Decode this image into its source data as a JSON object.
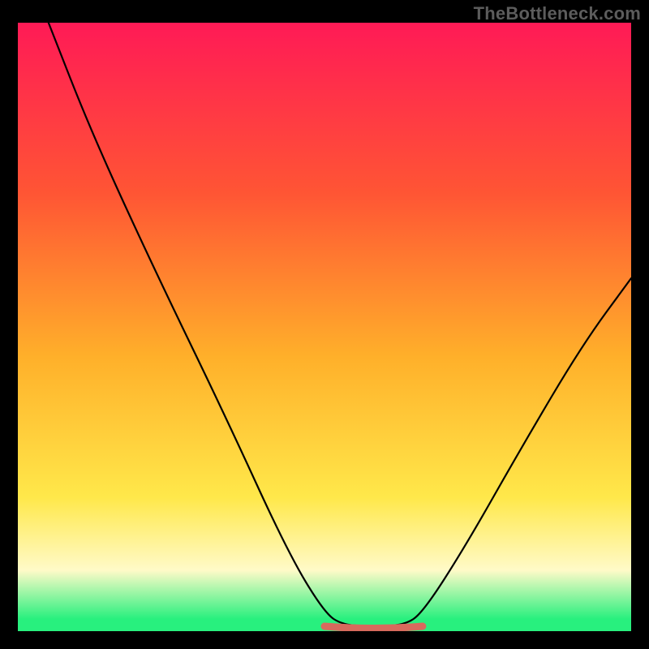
{
  "watermark": "TheBottleneck.com",
  "colors": {
    "background": "#000000",
    "watermark_text": "#5c5c5c",
    "gradient_top": "#ff1a56",
    "gradient_upper": "#ff5534",
    "gradient_mid": "#ffb02a",
    "gradient_lower": "#ffe84a",
    "gradient_pale": "#fffac8",
    "gradient_base": "#28f07e",
    "curve": "#000000",
    "highlight": "#d86a5d"
  },
  "chart_data": {
    "type": "line",
    "title": "",
    "xlabel": "",
    "ylabel": "",
    "xlim": [
      0,
      100
    ],
    "ylim": [
      0,
      100
    ],
    "gradient_stops": [
      {
        "offset": 0,
        "color": "#ff1a56"
      },
      {
        "offset": 28,
        "color": "#ff5534"
      },
      {
        "offset": 55,
        "color": "#ffb02a"
      },
      {
        "offset": 78,
        "color": "#ffe84a"
      },
      {
        "offset": 90,
        "color": "#fffac8"
      },
      {
        "offset": 98,
        "color": "#28f07e"
      },
      {
        "offset": 100,
        "color": "#28f07e"
      }
    ],
    "series": [
      {
        "name": "bottleneck-curve",
        "points": [
          {
            "x": 5,
            "y": 100
          },
          {
            "x": 12,
            "y": 82
          },
          {
            "x": 22,
            "y": 60
          },
          {
            "x": 34,
            "y": 35
          },
          {
            "x": 44,
            "y": 13
          },
          {
            "x": 50,
            "y": 3
          },
          {
            "x": 53,
            "y": 1
          },
          {
            "x": 58,
            "y": 0.8
          },
          {
            "x": 63,
            "y": 1
          },
          {
            "x": 66,
            "y": 3
          },
          {
            "x": 73,
            "y": 14
          },
          {
            "x": 82,
            "y": 30
          },
          {
            "x": 92,
            "y": 47
          },
          {
            "x": 100,
            "y": 58
          }
        ]
      }
    ],
    "highlight_segment": {
      "x_start": 50,
      "x_end": 66,
      "y": 1.2
    }
  }
}
